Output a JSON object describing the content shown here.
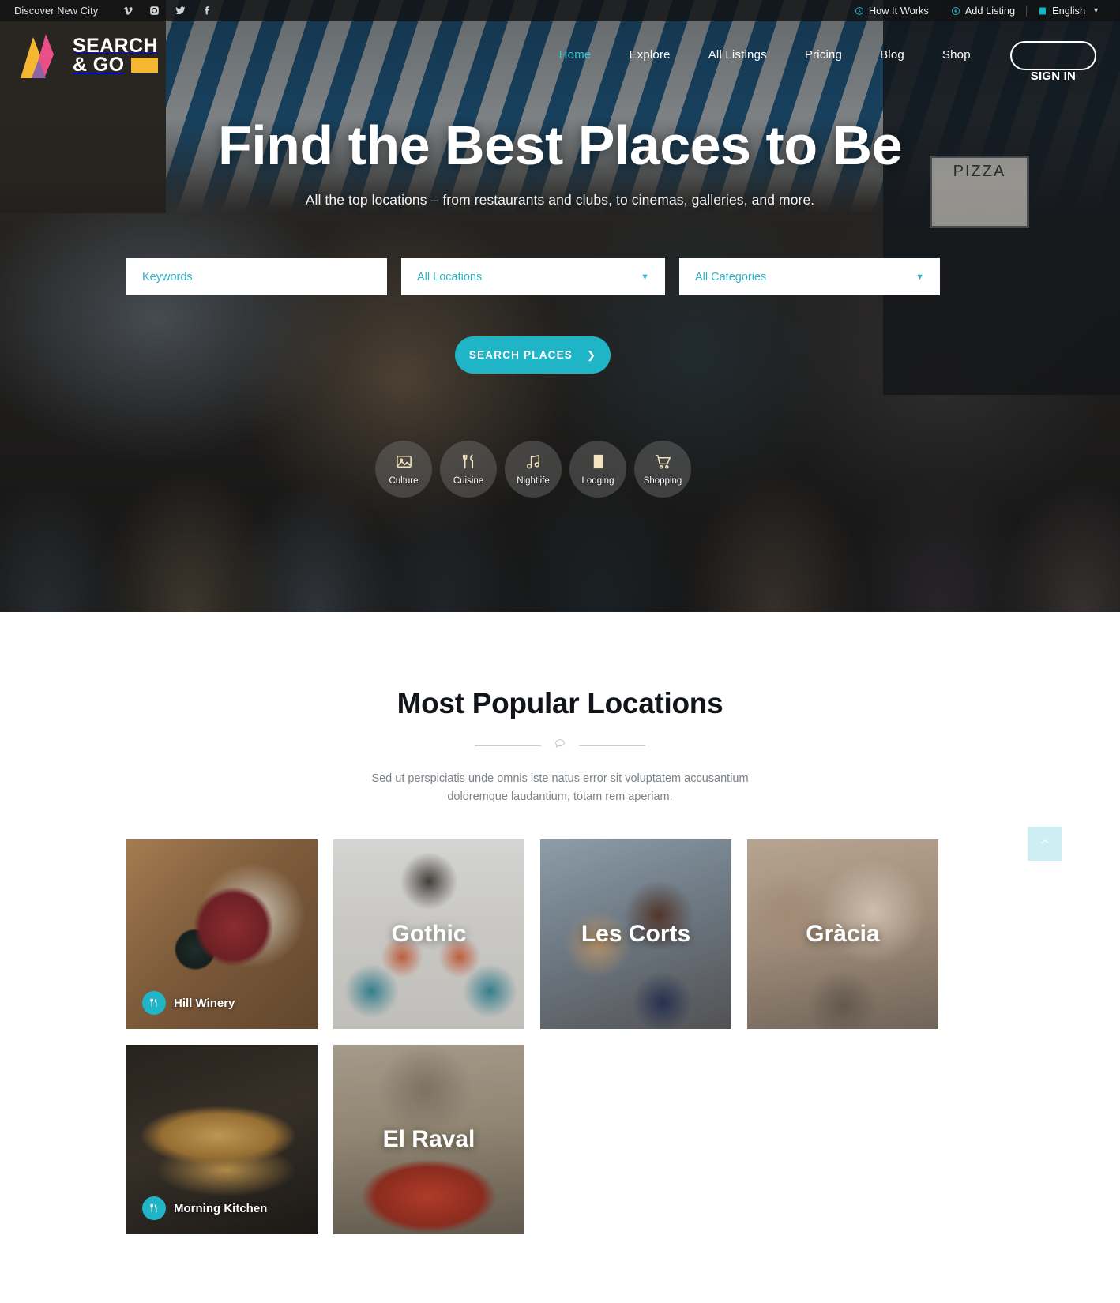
{
  "topbar": {
    "tagline": "Discover New City",
    "social": [
      {
        "name": "vimeo",
        "label": "Vimeo"
      },
      {
        "name": "instagram",
        "label": "Instagram"
      },
      {
        "name": "twitter",
        "label": "Twitter"
      },
      {
        "name": "facebook",
        "label": "Facebook"
      }
    ],
    "how_it_works": "How It Works",
    "add_listing": "Add Listing",
    "language": "English"
  },
  "logo": {
    "line1": "SEARCH",
    "line2": "& GO"
  },
  "nav": {
    "items": [
      {
        "label": "Home",
        "active": true
      },
      {
        "label": "Explore",
        "active": false
      },
      {
        "label": "All Listings",
        "active": false
      },
      {
        "label": "Pricing",
        "active": false
      },
      {
        "label": "Blog",
        "active": false
      },
      {
        "label": "Shop",
        "active": false
      }
    ],
    "signin": "SIGN IN"
  },
  "hero": {
    "title": "Find the Best Places to Be",
    "subtitle": "All the top locations – from restaurants and clubs, to cinemas, galleries, and more.",
    "search": {
      "keywords_placeholder": "Keywords",
      "keywords_value": "",
      "locations_selected": "All Locations",
      "categories_selected": "All Categories",
      "button_label": "SEARCH PLACES"
    },
    "categories": [
      {
        "label": "Culture",
        "icon": "image-icon"
      },
      {
        "label": "Cuisine",
        "icon": "cutlery-icon"
      },
      {
        "label": "Nightlife",
        "icon": "music-note-icon"
      },
      {
        "label": "Lodging",
        "icon": "building-icon"
      },
      {
        "label": "Shopping",
        "icon": "shopping-cart-icon"
      }
    ]
  },
  "popular": {
    "title": "Most Popular Locations",
    "subtitle_line1": "Sed ut perspiciatis unde omnis iste natus error sit voluptatem accusantium",
    "subtitle_line2": "doloremque laudantium, totam rem aperiam.",
    "cards": [
      {
        "style": "ph-winery",
        "badge": "Hill Winery",
        "badge_icon": "cutlery-icon",
        "big_title": ""
      },
      {
        "style": "ph-gothic",
        "badge": "",
        "badge_icon": "",
        "big_title": "Gothic"
      },
      {
        "style": "ph-lescorts",
        "badge": "",
        "badge_icon": "",
        "big_title": "Les Corts"
      },
      {
        "style": "ph-gracia",
        "badge": "",
        "badge_icon": "",
        "big_title": "Gràcia"
      },
      {
        "style": "ph-morning",
        "badge": "Morning Kitchen",
        "badge_icon": "cutlery-icon",
        "big_title": ""
      },
      {
        "style": "ph-elraval",
        "badge": "",
        "badge_icon": "",
        "big_title": "El Raval"
      }
    ]
  },
  "colors": {
    "accent": "#1fb5c6",
    "accent_light": "#3fc6d6",
    "logo_yellow": "#f5b731",
    "scrolltop_bg": "#cdeef3"
  }
}
